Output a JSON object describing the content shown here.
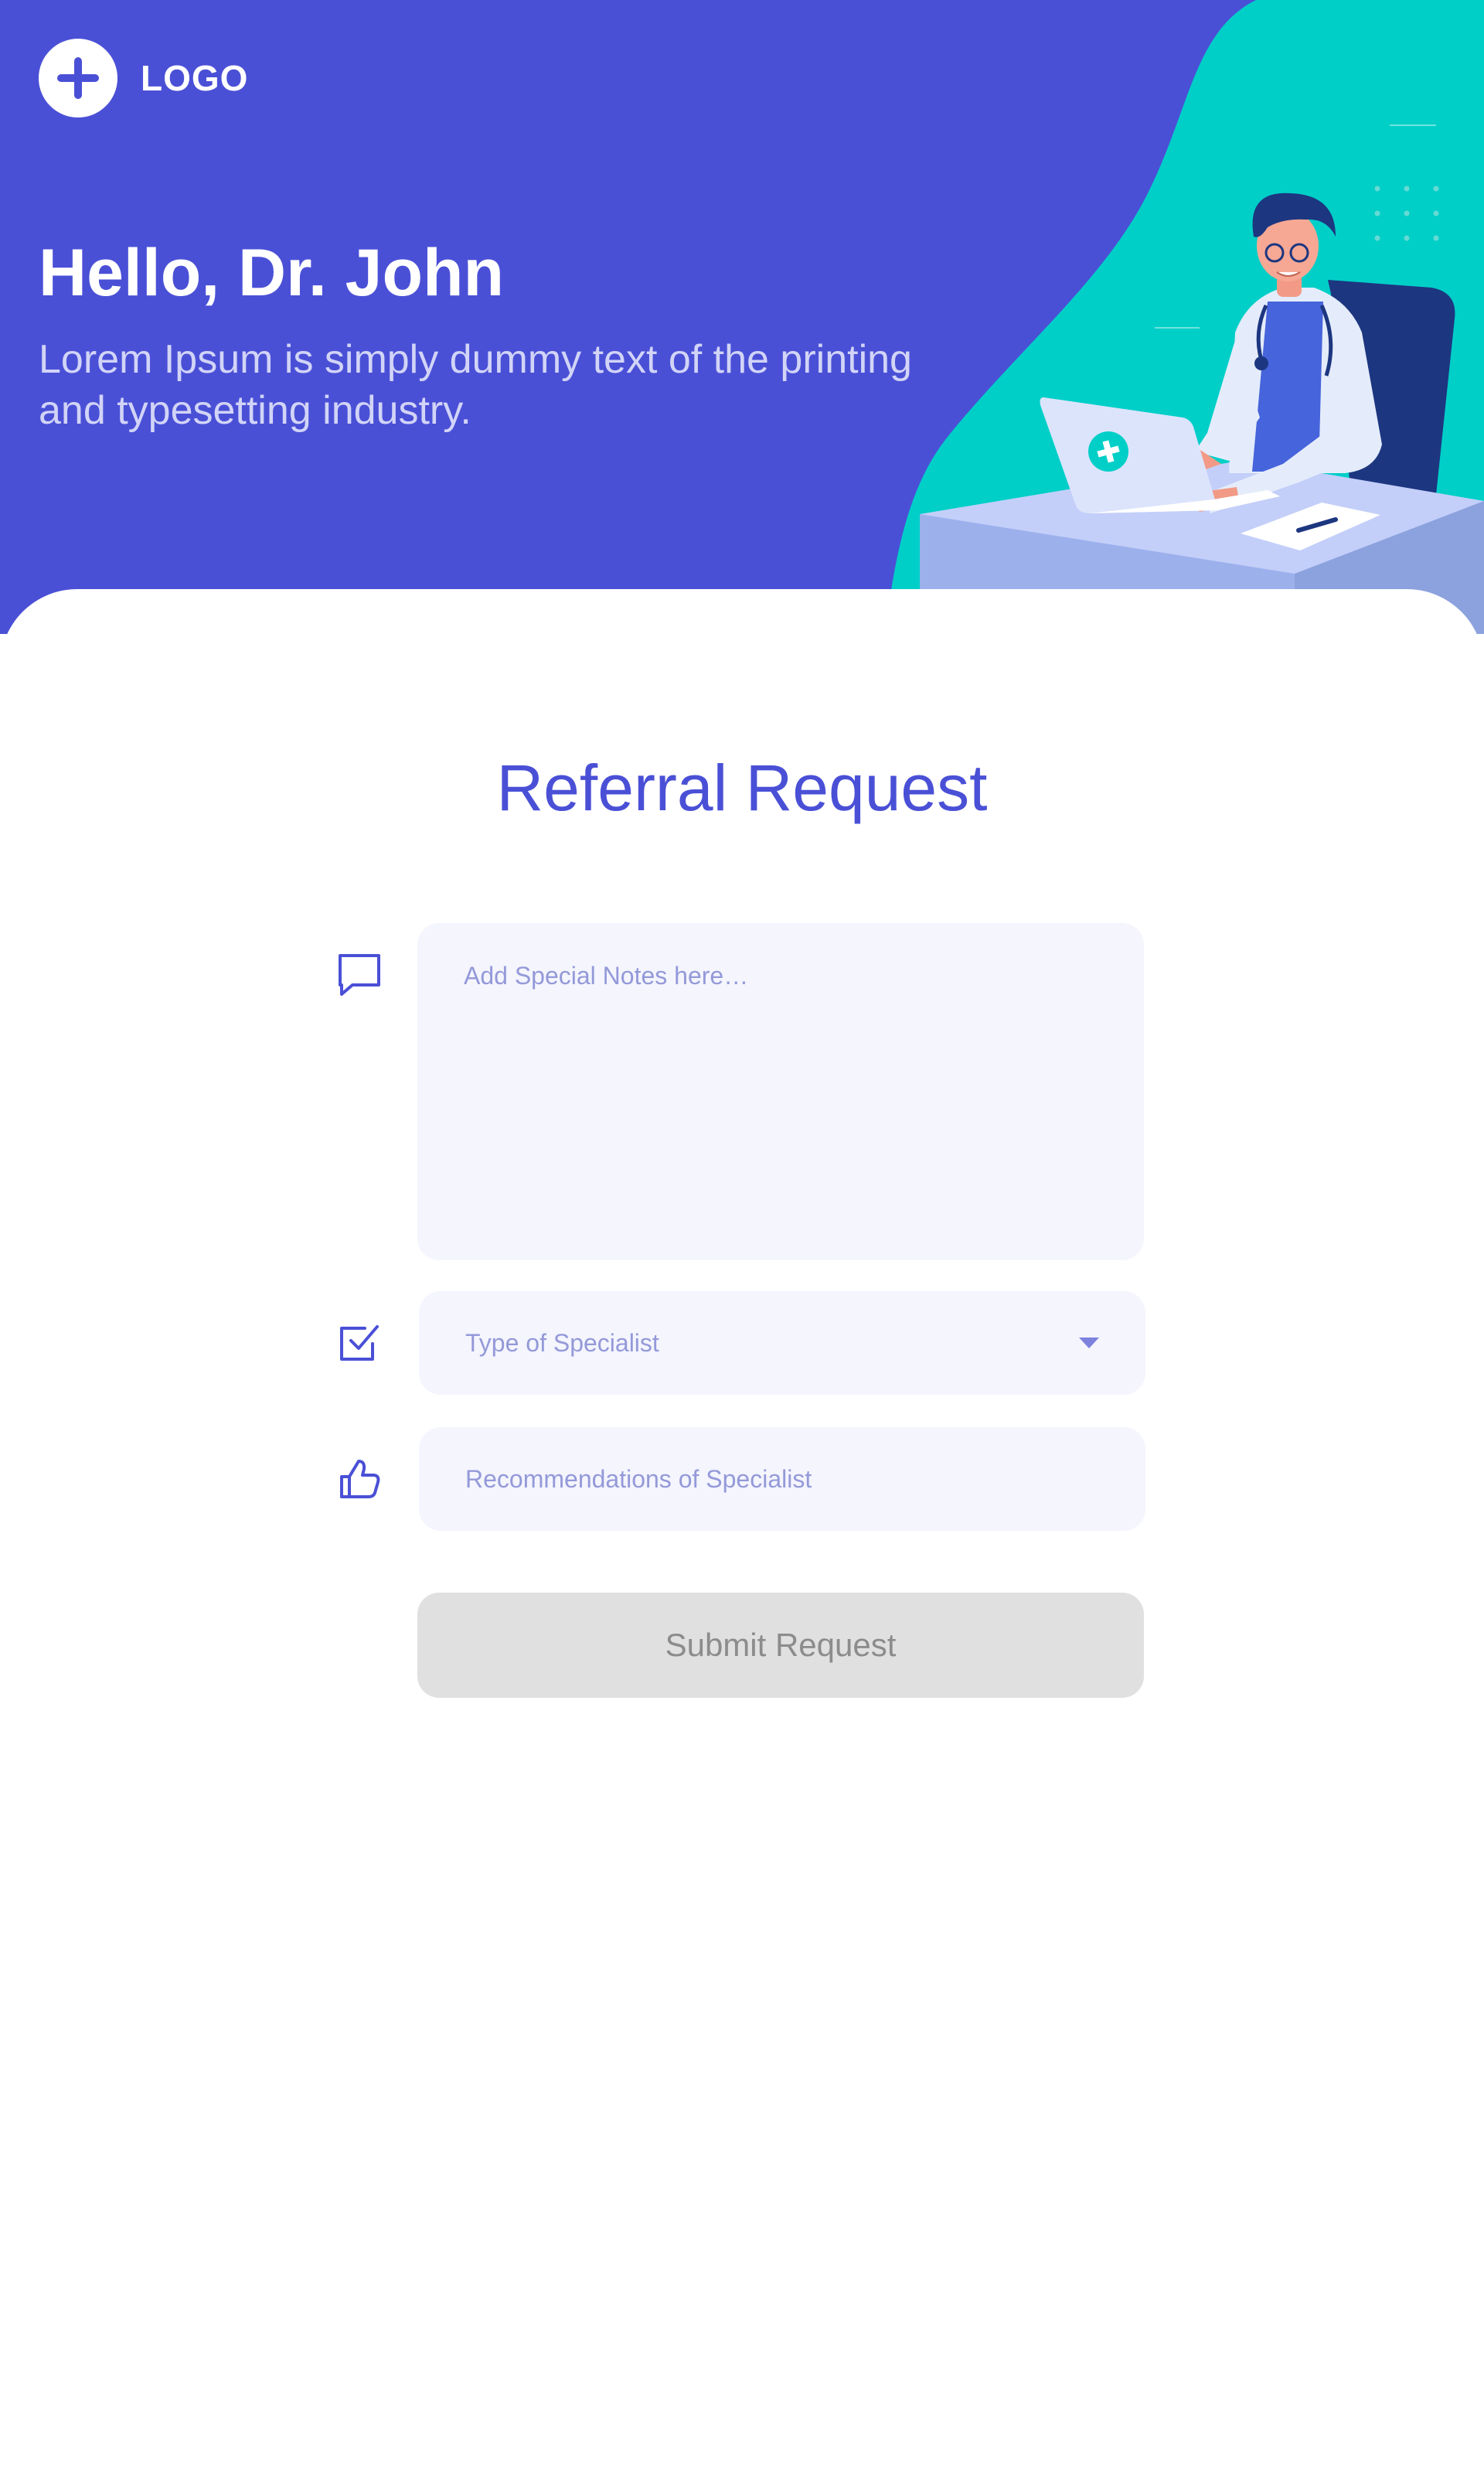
{
  "header": {
    "logo_text": "LOGO",
    "greeting": "Hello, Dr. John",
    "subtitle": "Lorem Ipsum is simply dummy text of the printing and typesetting industry."
  },
  "form": {
    "title": "Referral Request",
    "notes_placeholder": "Add Special Notes here…",
    "specialist_type_placeholder": "Type of Specialist",
    "recommendations_placeholder": "Recommendations of Specialist",
    "submit_label": "Submit Request"
  },
  "icons": {
    "logo": "plus-icon",
    "notes": "chat-bubble-icon",
    "specialist_type": "checkbox-icon",
    "recommendations": "thumbs-up-icon",
    "dropdown": "caret-down-icon"
  },
  "colors": {
    "primary": "#4A50D6",
    "accent": "#00CFC8",
    "field_background": "#F4F5FD",
    "placeholder": "#9499D9",
    "button_disabled": "#E0E0E0",
    "button_text_disabled": "#8C8C8C"
  }
}
